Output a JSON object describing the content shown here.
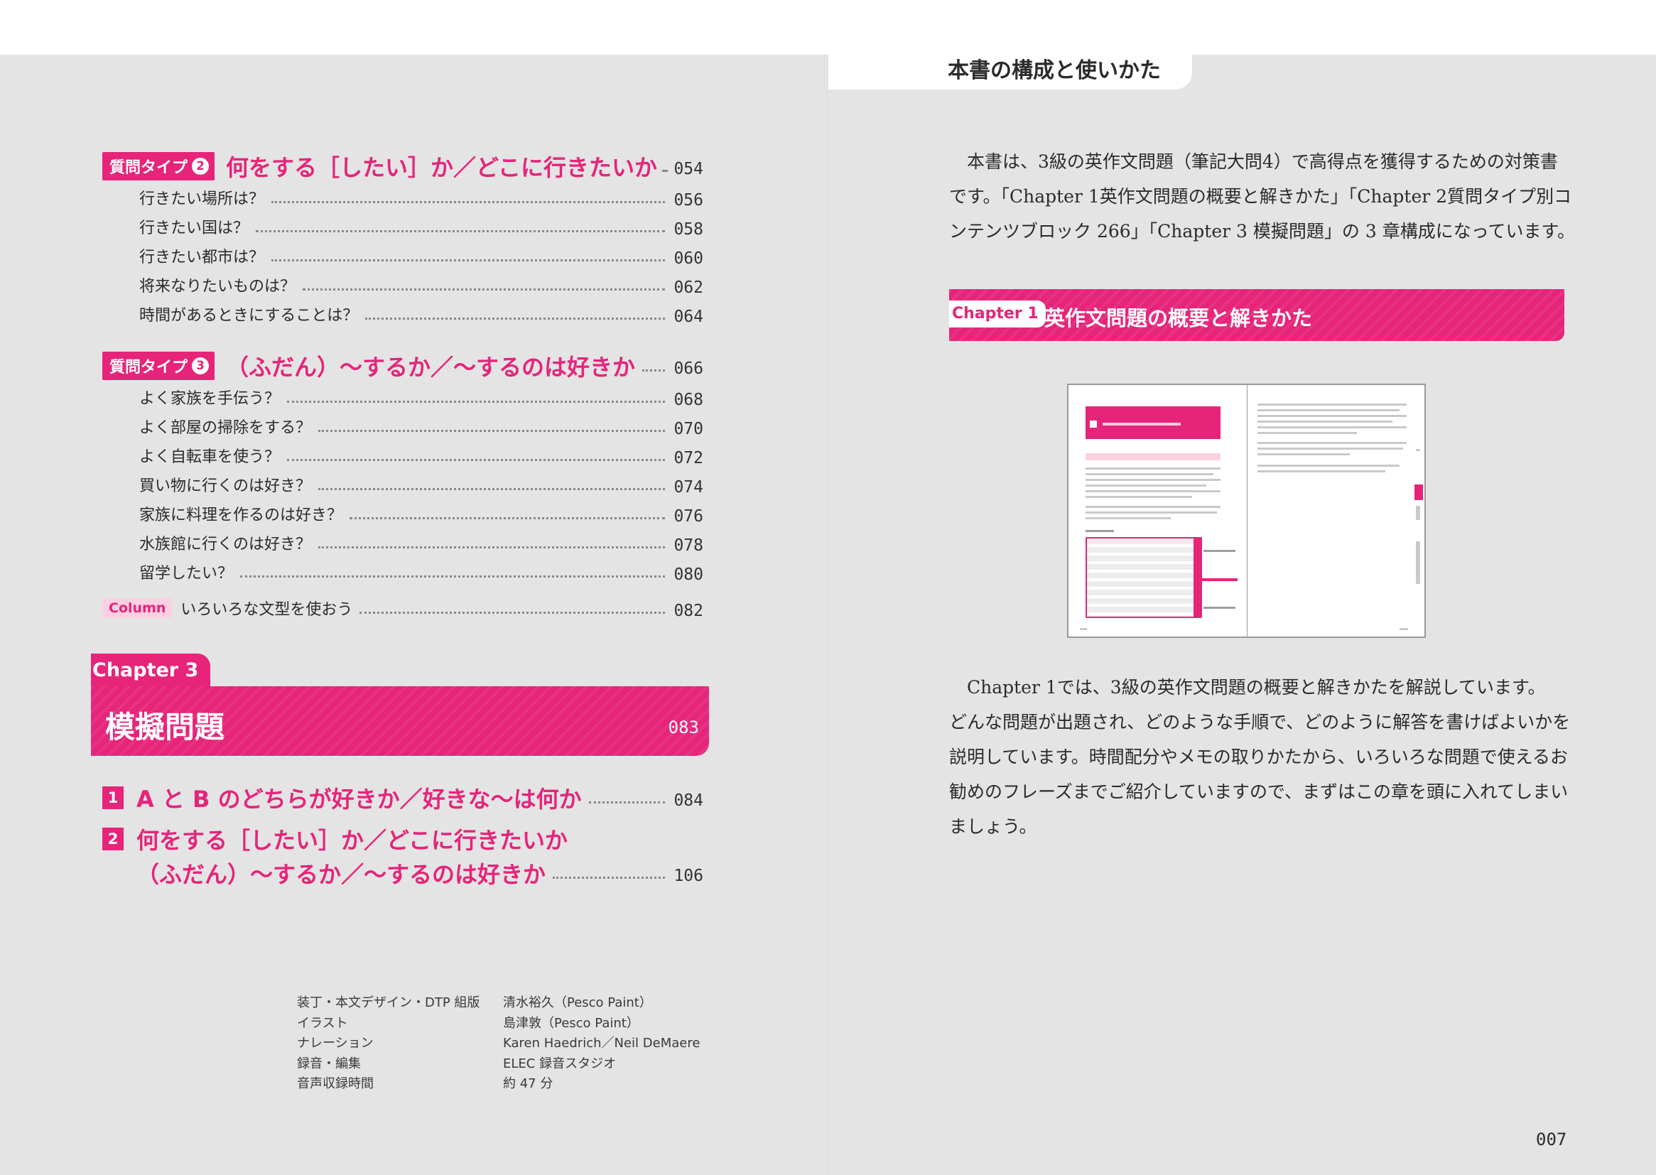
{
  "right_page": {
    "header": "本書の構成と使いかた",
    "intro": [
      "本書は、3級の英作文問題（筆記大問4）で高得点を獲得するための対策書",
      "です。「Chapter 1英作文問題の概要と解きかた」「Chapter 2質問タイプ別コ",
      "ンテンツブロック 266」「Chapter 3 模擬問題」の 3 章構成になっています。"
    ],
    "chapter1": {
      "tag": "Chapter 1",
      "title": "英作文問題の概要と解きかた"
    },
    "description": [
      "Chapter 1では、3級の英作文問題の概要と解きかたを解説しています。",
      "どんな問題が出題され、どのような手順で、どのように解答を書けばよいかを",
      "説明しています。時間配分やメモの取りかたから、いろいろな問題で使えるお",
      "勧めのフレーズまでご紹介していますので、まずはこの章を頭に入れてしまい",
      "ましょう。"
    ],
    "page_number": "007"
  },
  "toc": {
    "type2": {
      "tag": "質問タイプ",
      "num": "2",
      "title": "何をする［したい］か／どこに行きたいか",
      "page": "054"
    },
    "type2_items": [
      {
        "label": "行きたい場所は？",
        "page": "056"
      },
      {
        "label": "行きたい国は？",
        "page": "058"
      },
      {
        "label": "行きたい都市は？",
        "page": "060"
      },
      {
        "label": "将来なりたいものは？",
        "page": "062"
      },
      {
        "label": "時間があるときにすることは？",
        "page": "064"
      }
    ],
    "type3": {
      "tag": "質問タイプ",
      "num": "3",
      "title": "（ふだん）〜するか／〜するのは好きか",
      "page": "066"
    },
    "type3_items": [
      {
        "label": "よく家族を手伝う？",
        "page": "068"
      },
      {
        "label": "よく部屋の掃除をする？",
        "page": "070"
      },
      {
        "label": "よく自転車を使う？",
        "page": "072"
      },
      {
        "label": "買い物に行くのは好き？",
        "page": "074"
      },
      {
        "label": "家族に料理を作るのは好き？",
        "page": "076"
      },
      {
        "label": "水族館に行くのは好き？",
        "page": "078"
      },
      {
        "label": "留学したい？",
        "page": "080"
      }
    ],
    "column": {
      "tag": "Column",
      "label": "いろいろな文型を使おう",
      "page": "082"
    },
    "chapter3": {
      "tag": "Chapter 3",
      "title": "模擬問題",
      "page": "083"
    },
    "chapter3_items": [
      {
        "num": "1",
        "lines": [
          "A と B のどちらが好きか／好きな〜は何か"
        ],
        "page": "084"
      },
      {
        "num": "2",
        "lines": [
          "何をする［したい］か／どこに行きたいか",
          "（ふだん）〜するか／〜するのは好きか"
        ],
        "page": "106"
      }
    ]
  },
  "credits": [
    {
      "role": "装丁・本文デザイン・DTP 組版",
      "name": "清水裕久（Pesco Paint）"
    },
    {
      "role": "イラスト",
      "name": "島津敦（Pesco Paint）"
    },
    {
      "role": "ナレーション",
      "name": "Karen Haedrich／Neil DeMaere"
    },
    {
      "role": "録音・編集",
      "name": "ELEC 録音スタジオ"
    },
    {
      "role": "音声収録時間",
      "name": "約 47 分"
    }
  ],
  "colors": {
    "accent": "#e6247a",
    "background": "#e4e4e4"
  }
}
